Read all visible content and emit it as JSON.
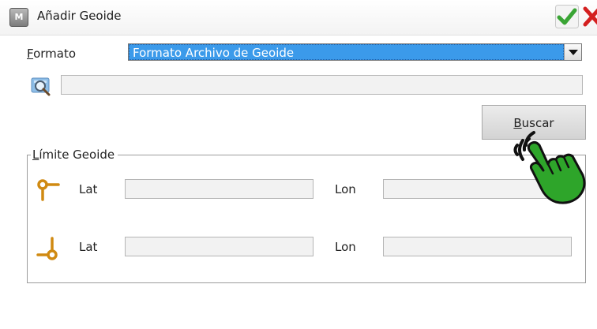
{
  "window": {
    "app_icon_text": "M",
    "title": "Añadir Geoide"
  },
  "form": {
    "format_label_accel": "F",
    "format_label_rest": "ormato",
    "format_selected": "Formato Archivo de Geoide",
    "path_value": "",
    "search_button_accel": "B",
    "search_button_rest": "uscar"
  },
  "boundary": {
    "legend_accel": "L",
    "legend_rest": "ímite Geoide",
    "row1": {
      "lat_label": "Lat",
      "lat_value": "",
      "lon_label": "Lon",
      "lon_value": ""
    },
    "row2": {
      "lat_label": "Lat",
      "lat_value": "",
      "lon_label": "Lon",
      "lon_value": ""
    }
  },
  "icons": {
    "ok": "check-icon",
    "close": "close-icon",
    "browse": "magnifier-icon",
    "top_corner": "top-left-corner-icon",
    "bottom_corner": "bottom-right-corner-icon",
    "tap": "tap-hand-icon"
  },
  "colors": {
    "selection": "#3b9aea",
    "ok": "#3aa535",
    "close": "#d42020",
    "corner_icon": "#d08a12",
    "hand": "#2ea52a"
  }
}
